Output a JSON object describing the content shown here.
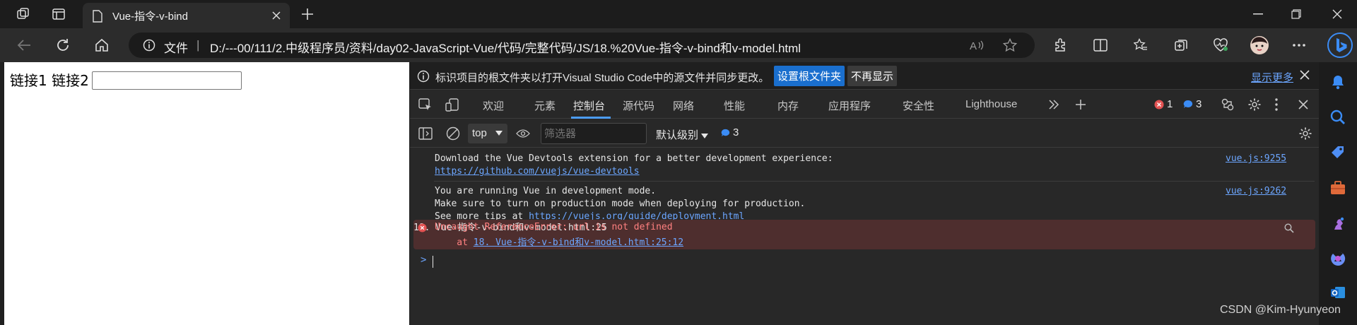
{
  "browser": {
    "tab_title": "Vue-指令-v-bind",
    "file_label": "文件",
    "separator": "|",
    "url": "D:/---00/111/2.中级程序员/资料/day02-JavaScript-Vue/代码/完整代码/JS/18.%20Vue-指令-v-bind和v-model.html"
  },
  "page": {
    "links_text": "链接1 链接2",
    "input_value": ""
  },
  "devtools": {
    "infobar": {
      "text": "标识项目的根文件夹以打开Visual Studio Code中的源文件并同步更改。",
      "primary_button": "设置根文件夹",
      "secondary_button": "不再显示",
      "more_link": "显示更多"
    },
    "tabs": [
      {
        "label": "欢迎"
      },
      {
        "label": "元素"
      },
      {
        "label": "控制台"
      },
      {
        "label": "源代码"
      },
      {
        "label": "网络"
      },
      {
        "label": "性能"
      },
      {
        "label": "内存"
      },
      {
        "label": "应用程序"
      },
      {
        "label": "安全性"
      },
      {
        "label": "Lighthouse"
      }
    ],
    "error_count": "1",
    "message_count": "3",
    "toolbar": {
      "context": "top",
      "filter_placeholder": "筛选器",
      "level": "默认级别",
      "count": "3"
    },
    "messages": [
      {
        "lines": [
          "Download the Vue Devtools extension for a better development experience:"
        ],
        "link": "https://github.com/vuejs/vue-devtools",
        "source": "vue.js:9255"
      },
      {
        "lines": [
          "You are running Vue in development mode.",
          "Make sure to turn on production mode when deploying for production."
        ],
        "tip_prefix": "See more tips at ",
        "link": "https://vuejs.org/guide/deployment.html",
        "source": "vue.js:9262"
      },
      {
        "line": "Uncaught ReferenceError: url is not defined",
        "at_prefix": "    at ",
        "at_link": "18. Vue-指令-v-bind和v-model.html:25:12",
        "source": "18. Vue-指令-v-bind和v-model.html:25"
      }
    ],
    "prompt": ">"
  },
  "watermark": "CSDN @Kim-Hyunyeon"
}
